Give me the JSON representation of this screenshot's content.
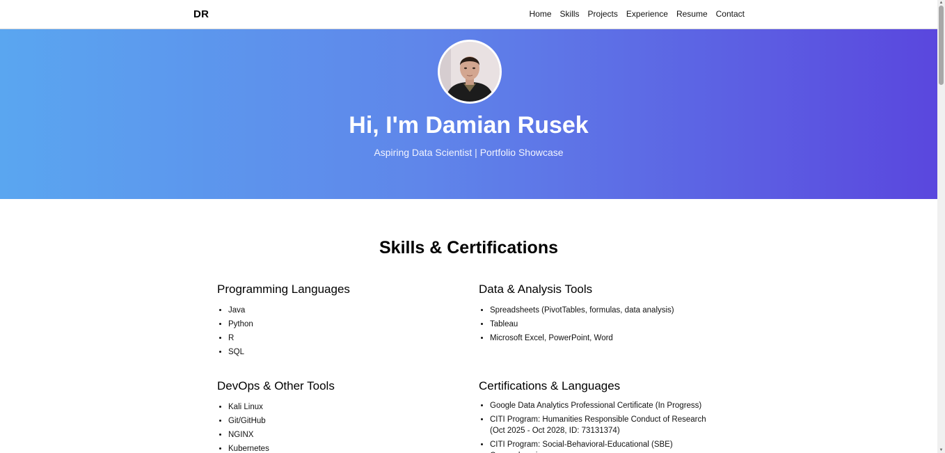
{
  "nav": {
    "brand": "DR",
    "links": [
      "Home",
      "Skills",
      "Projects",
      "Experience",
      "Resume",
      "Contact"
    ]
  },
  "hero": {
    "title": "Hi, I'm Damian Rusek",
    "subtitle": "Aspiring Data Scientist | Portfolio Showcase"
  },
  "skills": {
    "title": "Skills & Certifications",
    "groups": [
      {
        "title": "Programming Languages",
        "items": [
          "Java",
          "Python",
          "R",
          "SQL"
        ]
      },
      {
        "title": "Data & Analysis Tools",
        "items": [
          "Spreadsheets (PivotTables, formulas, data analysis)",
          "Tableau",
          "Microsoft Excel, PowerPoint, Word"
        ]
      },
      {
        "title": "DevOps & Other Tools",
        "items": [
          "Kali Linux",
          "Git/GitHub",
          "NGINX",
          "Kubernetes"
        ]
      },
      {
        "title": "Certifications & Languages",
        "items": [
          "Google Data Analytics Professional Certificate (In Progress)",
          "CITI Program: Humanities Responsible Conduct of Research (Oct 2025 - Oct 2028, ID: 73131374)",
          "CITI Program: Social-Behavioral-Educational (SBE) Comprehensive"
        ]
      }
    ]
  },
  "colors": {
    "hero_gradient_start": "#5aa6f0",
    "hero_gradient_end": "#5a47de"
  },
  "icons": {
    "avatar": "profile-photo"
  }
}
